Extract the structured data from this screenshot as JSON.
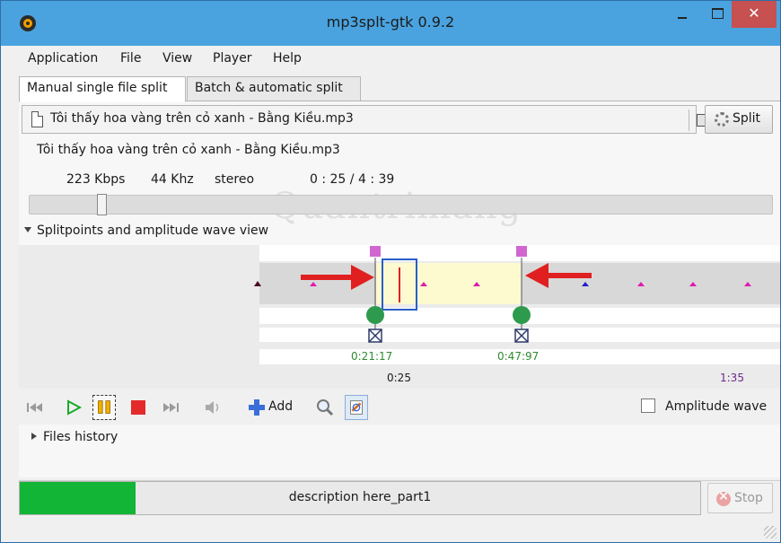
{
  "window": {
    "title": "mp3splt-gtk 0.9.2",
    "close_symbol": "✕"
  },
  "menu": {
    "items": [
      "Application",
      "File",
      "View",
      "Player",
      "Help"
    ]
  },
  "tabs": {
    "manual": "Manual single file split",
    "batch": "Batch & automatic split"
  },
  "file": {
    "path": "Tôi thấy hoa vàng trên cỏ xanh - Bằng Kiều.mp3",
    "split_label": "Split"
  },
  "info": {
    "name": "Tôi thấy hoa vàng trên cỏ xanh - Bằng Kiều.mp3",
    "bitrate": "223 Kbps",
    "frequency": "44 Khz",
    "mode": "stereo",
    "time": "0  :  25  /  4  :  39"
  },
  "playback": {
    "position_fraction": 0.09
  },
  "wave_section": {
    "title": "Splitpoints and amplitude wave view",
    "splitpoints": [
      "0:21:17",
      "0:47:97"
    ],
    "current_time": "0:25",
    "end_time": "1:35"
  },
  "toolbar": {
    "add_label": "Add",
    "amplitude_label": "Amplitude wave",
    "amplitude_checked": false
  },
  "history": {
    "label": "Files history"
  },
  "status": {
    "description": "description here_part1",
    "progress": 0.17,
    "stop_label": "Stop"
  },
  "watermark": {
    "text": "Quantrimang"
  },
  "colors": {
    "progress": "#12b535",
    "titlebar": "#4aa3df",
    "close": "#c75050",
    "splitpoint": "#2e9a4e",
    "arrow": "#e02020",
    "time_green": "#2e8b2e",
    "end_purple": "#6a2a8a"
  }
}
